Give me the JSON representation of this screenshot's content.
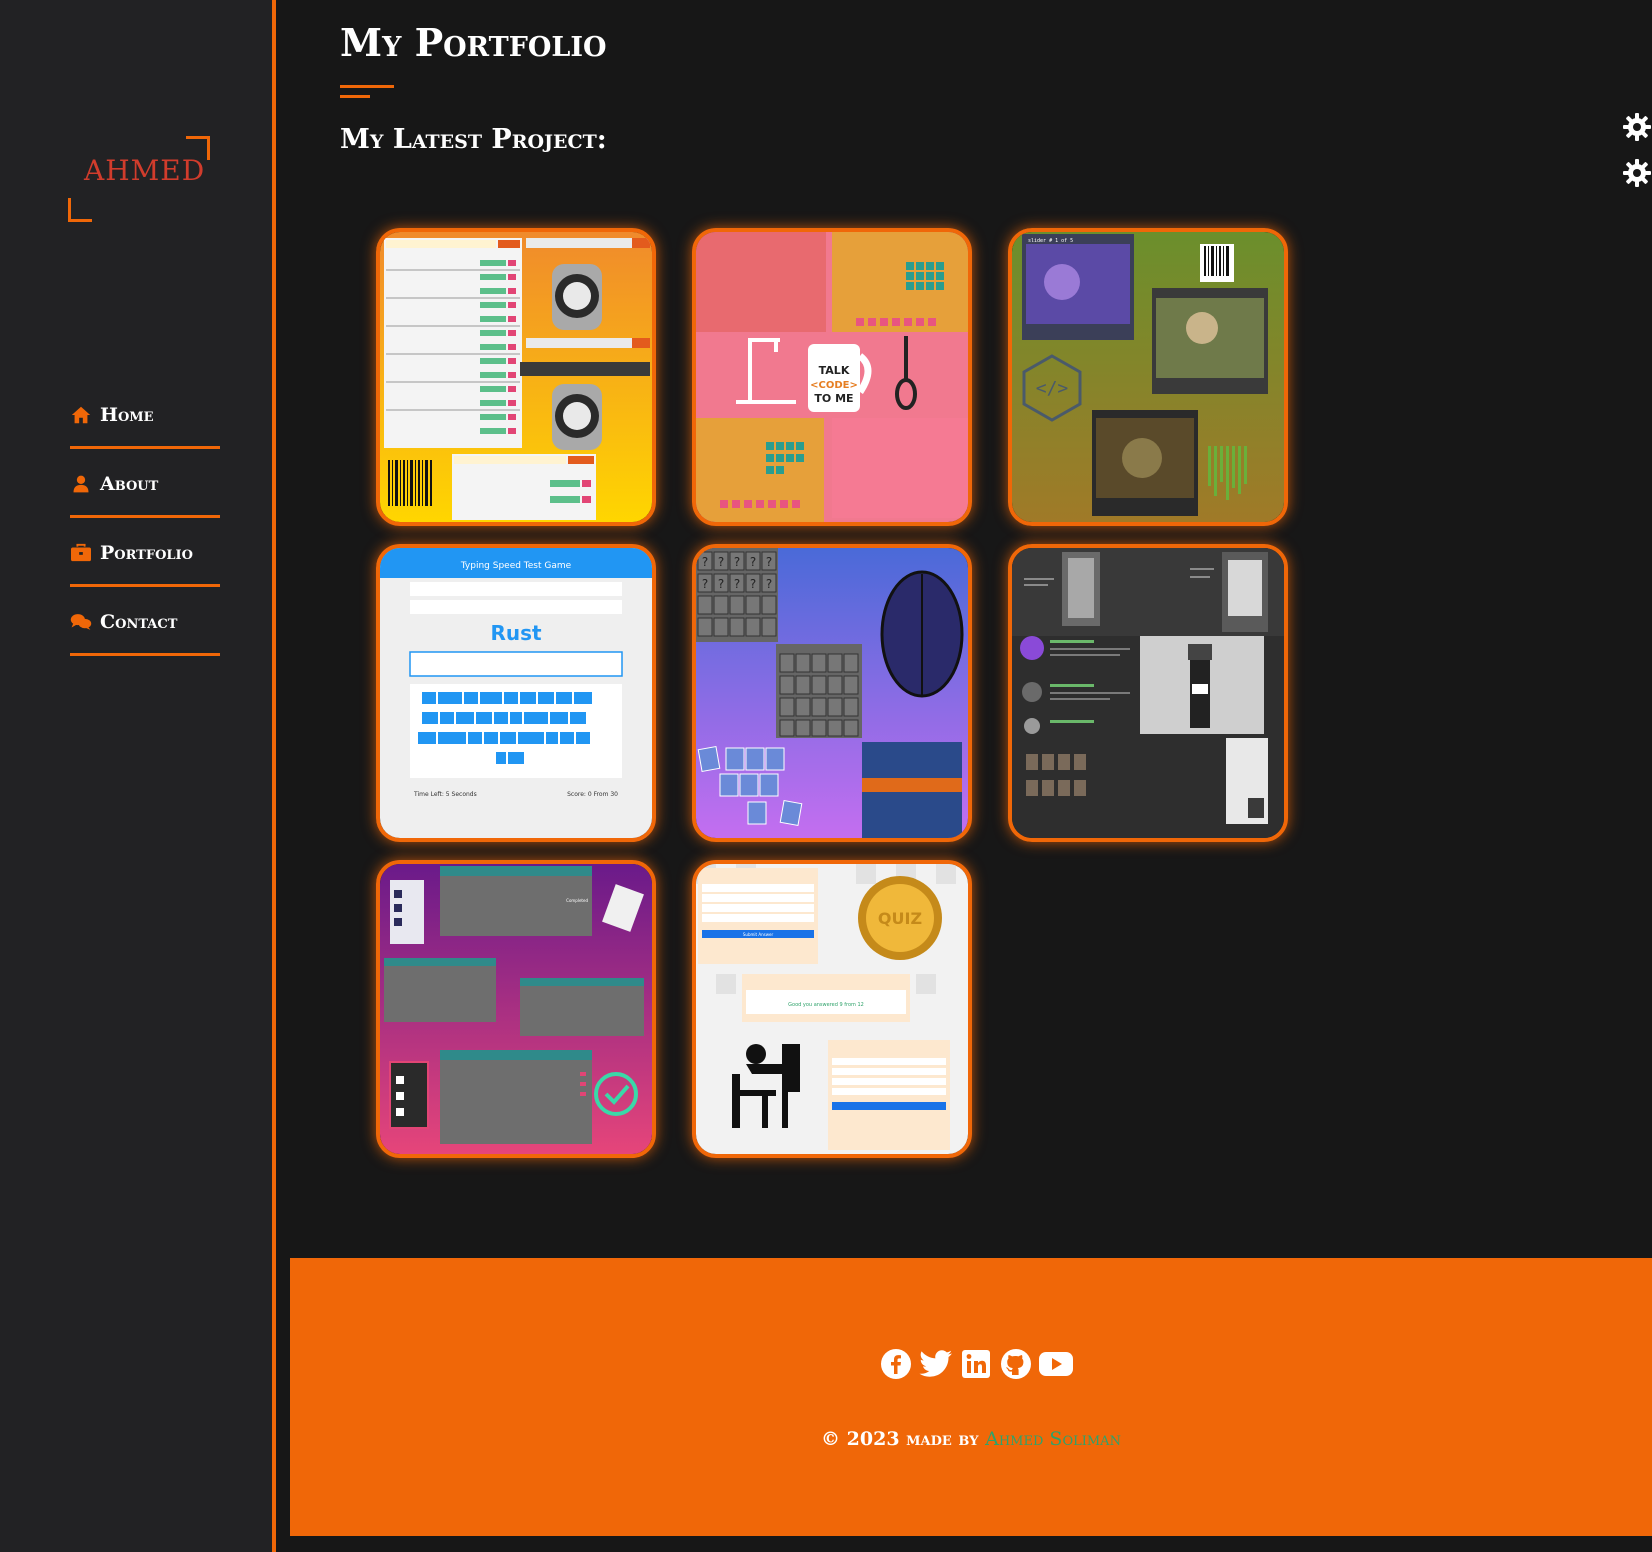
{
  "sidebar": {
    "logo": "AHMED",
    "nav": [
      {
        "label": "Home",
        "icon": "house-icon"
      },
      {
        "label": "About",
        "icon": "user-icon"
      },
      {
        "label": "Portfolio",
        "icon": "briefcase-icon"
      },
      {
        "label": "Contact",
        "icon": "comments-icon"
      }
    ]
  },
  "main": {
    "title": "My Portfolio",
    "subtitle": "My Latest Project:"
  },
  "settings": {
    "icons": [
      "gear-icon",
      "gear-icon"
    ]
  },
  "projects": [
    {
      "name": "GitHub repos viewer",
      "visible_text": [
        "Github Username",
        "Get Repos",
        "Please Enter User Name"
      ]
    },
    {
      "name": "Hangman game",
      "visible_text": [
        "TALK",
        "<CODE>",
        "TO ME"
      ]
    },
    {
      "name": "Image slider",
      "visible_text": [
        "slider # 1 of 5"
      ]
    },
    {
      "name": "Typing speed test game",
      "visible_text": [
        "Typing Speed Test Game",
        "Rust",
        "Time Left: 5 Seconds",
        "Score: 0 From 30"
      ]
    },
    {
      "name": "Memory game",
      "visible_text": [
        "?"
      ]
    },
    {
      "name": "Template",
      "visible_text": []
    },
    {
      "name": "Todo app",
      "visible_text": [
        "Completed"
      ]
    },
    {
      "name": "Quiz app",
      "visible_text": [
        "QUIZ",
        "Submit Answer",
        "Good you answered 9 from 12"
      ]
    }
  ],
  "footer": {
    "socials": [
      "facebook-icon",
      "twitter-icon",
      "linkedin-icon",
      "github-icon",
      "youtube-icon"
    ],
    "copyright_prefix": "© 2023 made by",
    "author": "Ahmed Soliman"
  },
  "colors": {
    "accent": "#f06708",
    "background": "#171717",
    "sidebar": "#222224",
    "logo_text": "#d13c2c",
    "author": "#2fa26a"
  }
}
